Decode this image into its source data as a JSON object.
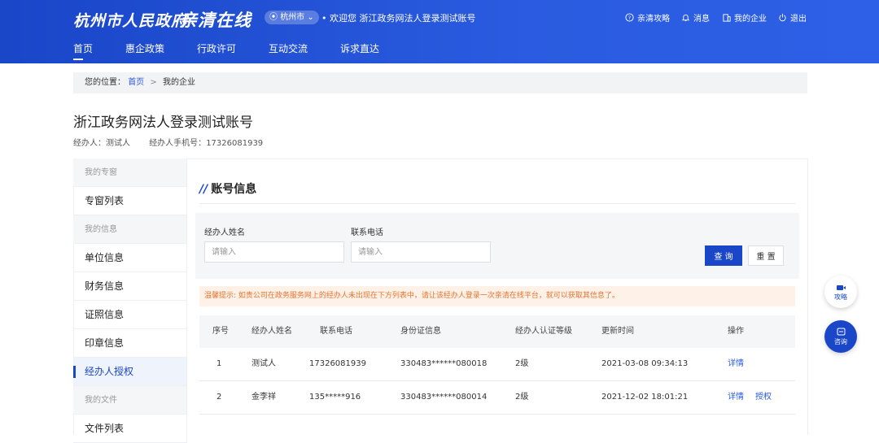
{
  "header": {
    "logo_main": "杭州市人民政府",
    "logo_sub": "亲清在线",
    "city": "杭州市",
    "welcome": "• 欢迎您 浙江政务网法人登录测试账号",
    "links": {
      "guide": "亲清攻略",
      "message": "消息",
      "my_company": "我的企业",
      "logout": "退出"
    }
  },
  "nav": [
    "首页",
    "惠企政策",
    "行政许可",
    "互动交流",
    "诉求直达"
  ],
  "breadcrumb": {
    "prefix": "您的位置：",
    "home": "首页",
    "sep": ">",
    "current": "我的企业"
  },
  "company": {
    "name": "浙江政务网法人登录测试账号",
    "agent_label": "经办人：",
    "agent": "测试人",
    "phone_label": "经办人手机号：",
    "phone": "17326081939"
  },
  "sidebar": {
    "items": [
      {
        "label": "我的专窗",
        "group": true
      },
      {
        "label": "专窗列表"
      },
      {
        "label": "我的信息",
        "group": true
      },
      {
        "label": "单位信息"
      },
      {
        "label": "财务信息"
      },
      {
        "label": "证照信息"
      },
      {
        "label": "印章信息"
      },
      {
        "label": "经办人授权",
        "active": true
      },
      {
        "label": "我的文件",
        "group": true
      },
      {
        "label": "文件列表"
      }
    ]
  },
  "section": {
    "slashes": "//",
    "title": "账号信息"
  },
  "filter": {
    "name_label": "经办人姓名",
    "name_placeholder": "请输入",
    "phone_label": "联系电话",
    "phone_placeholder": "请输入",
    "query_label": "查 询",
    "reset_label": "重 置"
  },
  "tip": "温馨提示: 如贵公司在政务服务网上的经办人未出现在下方列表中，请让该经办人登录一次亲清在线平台，就可以获取其信息了。",
  "table": {
    "headers": [
      "序号",
      "经办人姓名",
      "联系电话",
      "身份证信息",
      "经办人认证等级",
      "更新时间",
      "操作"
    ],
    "rows": [
      {
        "no": "1",
        "name": "测试人",
        "phone": "17326081939",
        "id": "330483******080018",
        "level": "2级",
        "time": "2021-03-08 09:34:13",
        "actions": [
          "详情"
        ]
      },
      {
        "no": "2",
        "name": "金李祥",
        "phone": "135*****916",
        "id": "330483******080014",
        "level": "2级",
        "time": "2021-12-02 18:01:21",
        "actions": [
          "详情",
          "授权"
        ]
      }
    ]
  },
  "float": {
    "guide": "攻略",
    "consult": "咨询"
  },
  "colors": {
    "primary": "#1a46c8",
    "tip_bg": "#fdf1e8",
    "tip_text": "#e8732c"
  }
}
